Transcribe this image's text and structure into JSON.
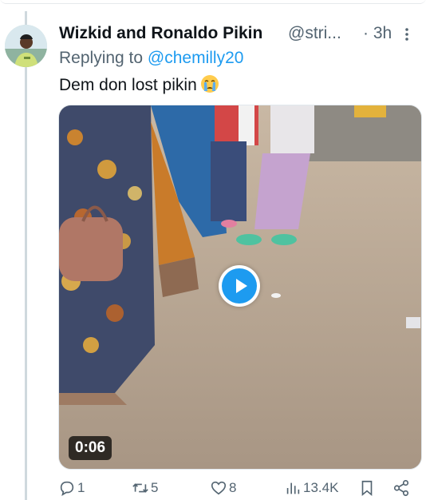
{
  "tweet": {
    "display_name": "Wizkid and Ronaldo Pikin",
    "handle": "@stri...",
    "time": "· 3h",
    "replying_prefix": "Replying to ",
    "replying_to": "@chemilly20",
    "text": "Dem don lost pikin",
    "emoji": "crying-face-emoji"
  },
  "media": {
    "type": "video",
    "duration": "0:06"
  },
  "actions": {
    "reply_count": "1",
    "retweet_count": "5",
    "like_count": "8",
    "views_count": "13.4K"
  },
  "colors": {
    "accent": "#1d9bf0",
    "secondary_text": "#536471",
    "primary_text": "#0f1419",
    "thread_line": "#cfd9de"
  }
}
